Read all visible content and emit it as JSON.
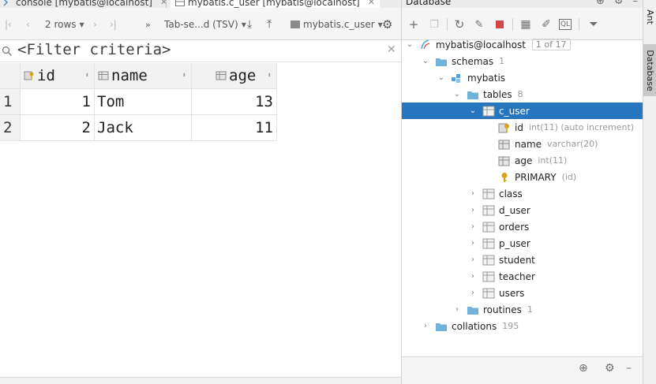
{
  "tabs": [
    {
      "label": "console [mybatis@localhost]",
      "active": false
    },
    {
      "label": "mybatis.c_user [mybatis@localhost]",
      "active": true
    }
  ],
  "toolbar": {
    "rows_label": "2 rows",
    "format_label": "Tab-se...d (TSV)",
    "datasource_label": "mybatis.c_user"
  },
  "filter": {
    "placeholder": "<Filter criteria>"
  },
  "table": {
    "columns": [
      "id",
      "name",
      "age"
    ],
    "rows": [
      {
        "num": "1",
        "id": "1",
        "name": "Tom",
        "age": "13"
      },
      {
        "num": "2",
        "id": "2",
        "name": "Jack",
        "age": "11"
      }
    ]
  },
  "database": {
    "title": "Database",
    "root": {
      "label": "mybatis@localhost",
      "badge": "1 of 17"
    },
    "schemas": {
      "label": "schemas",
      "count": "1"
    },
    "schema": {
      "label": "mybatis"
    },
    "tables": {
      "label": "tables",
      "count": "8"
    },
    "selected_table": "c_user",
    "columns": [
      {
        "name": "id",
        "type": "int(11) (auto increment)"
      },
      {
        "name": "name",
        "type": "varchar(20)"
      },
      {
        "name": "age",
        "type": "int(11)"
      }
    ],
    "primary_key": {
      "name": "PRIMARY",
      "cols": "(id)"
    },
    "other_tables": [
      "class",
      "d_user",
      "orders",
      "p_user",
      "student",
      "teacher",
      "users"
    ],
    "routines": {
      "label": "routines",
      "count": "1"
    },
    "collations": {
      "label": "collations",
      "count": "195"
    }
  },
  "side_tabs": [
    "Ant",
    "Database"
  ],
  "colors": {
    "selection": "#2675bf",
    "table_icon": "#7a7a7a",
    "folder": "#6fb3d9",
    "key": "#d9a514"
  }
}
